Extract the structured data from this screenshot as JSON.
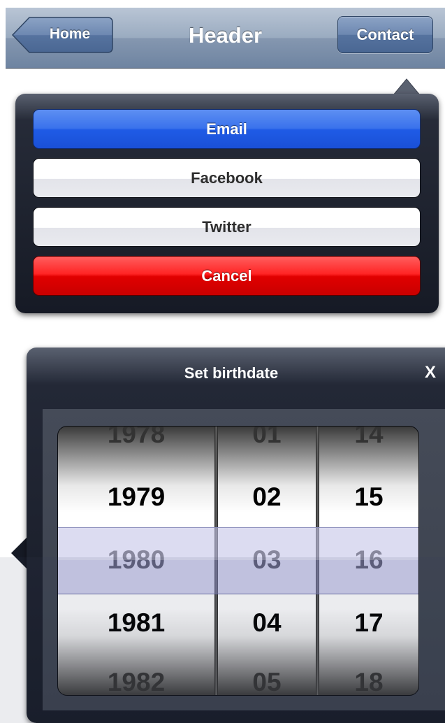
{
  "header": {
    "title": "Header",
    "home_label": "Home",
    "contact_label": "Contact"
  },
  "share_popover": {
    "buttons": [
      {
        "label": "Email",
        "color": "#1f5be6"
      },
      {
        "label": "Facebook",
        "color": "#ffffff"
      },
      {
        "label": "Twitter",
        "color": "#ffffff"
      },
      {
        "label": "Cancel",
        "color": "#e10000"
      }
    ]
  },
  "date_popover": {
    "title": "Set birthdate",
    "close_label": "X",
    "years": [
      "1978",
      "1979",
      "1980",
      "1981",
      "1982"
    ],
    "months": [
      "01",
      "02",
      "03",
      "04",
      "05"
    ],
    "days": [
      "14",
      "15",
      "16",
      "17",
      "18"
    ],
    "selected": {
      "year": "1980",
      "month": "03",
      "day": "16"
    }
  }
}
